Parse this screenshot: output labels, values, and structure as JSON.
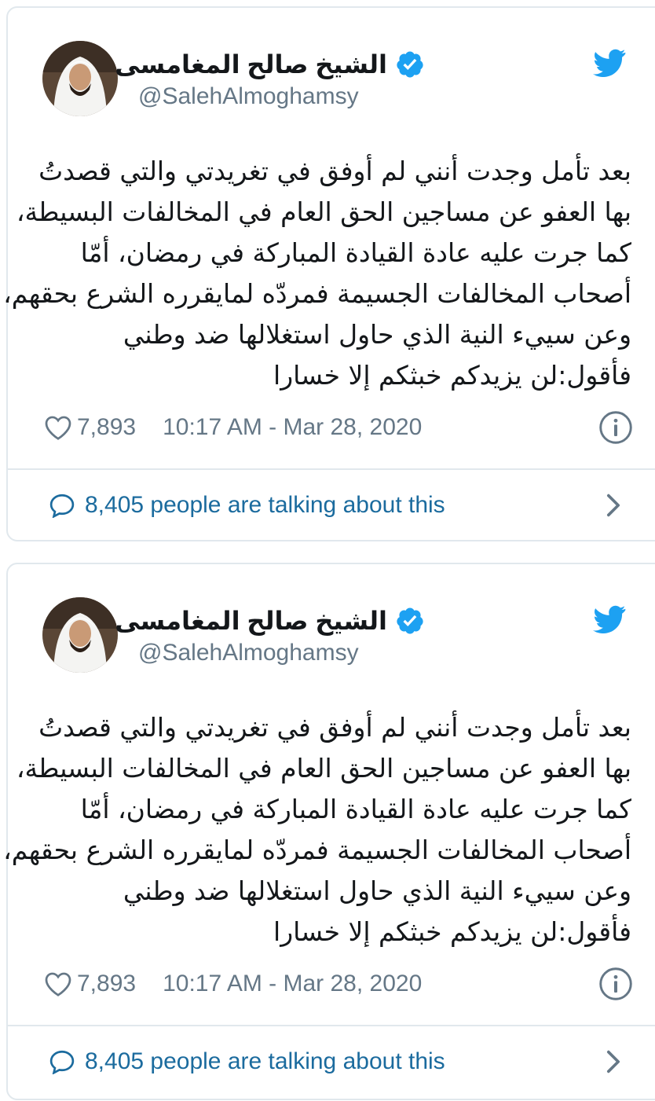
{
  "colors": {
    "twitter_blue": "#1da1f2",
    "link_blue": "#1b6b9e",
    "secondary_text": "#657786",
    "border": "#e1e8ed"
  },
  "icons": [
    "twitter-bird-icon",
    "verified-badge-icon",
    "heart-icon",
    "info-icon",
    "speech-bubble-icon",
    "chevron-right-icon"
  ],
  "tweets": [
    {
      "display_name": "الشيخ صالح المغامسى",
      "handle": "@SalehAlmoghamsy",
      "lines": [
        "بعد تأمل وجدت أنني لم أوفق في تغريدتي والتي قصدتُ",
        "بها العفو عن مساجين الحق العام في المخالفات البسيطة،",
        "كما جرت عليه عادة القيادة المباركة في رمضان، أمّا",
        "أصحاب المخالفات الجسيمة فمردّه لمايقرره الشرع بحقهم،",
        "وعن سييء النية الذي حاول استغلالها ضد وطني",
        "فأقول:لن يزيدكم خبثكم إلا خسارا"
      ],
      "likes": "7,893",
      "timestamp": "10:17 AM - Mar 28, 2020",
      "talking": "8,405 people are talking about this"
    },
    {
      "display_name": "الشيخ صالح المغامسى",
      "handle": "@SalehAlmoghamsy",
      "lines": [
        "بعد تأمل وجدت أنني لم أوفق في تغريدتي والتي قصدتُ",
        "بها العفو عن مساجين الحق العام في المخالفات البسيطة،",
        "كما جرت عليه عادة القيادة المباركة في رمضان، أمّا",
        "أصحاب المخالفات الجسيمة فمردّه لمايقرره الشرع بحقهم،",
        "وعن سييء النية الذي حاول استغلالها ضد وطني",
        "فأقول:لن يزيدكم خبثكم إلا خسارا"
      ],
      "likes": "7,893",
      "timestamp": "10:17 AM - Mar 28, 2020",
      "talking": "8,405 people are talking about this"
    }
  ]
}
